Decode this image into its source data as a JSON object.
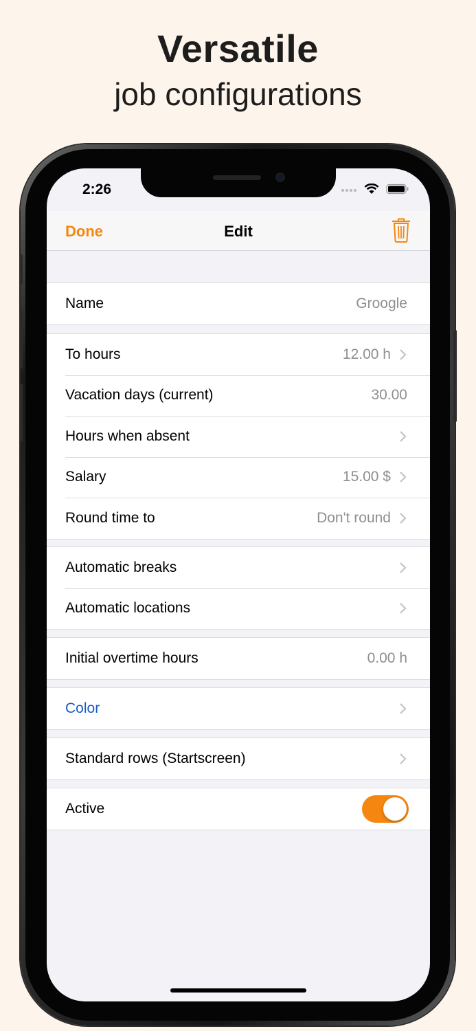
{
  "headline": {
    "title": "Versatile",
    "subtitle": "job configurations"
  },
  "status_bar": {
    "time": "2:26"
  },
  "nav": {
    "done_label": "Done",
    "title": "Edit",
    "trash_icon": "trash-icon"
  },
  "sections": {
    "name": {
      "label": "Name",
      "value": "Groogle"
    },
    "hours": [
      {
        "label": "To hours",
        "value": "12.00 h",
        "chevron": true
      },
      {
        "label": "Vacation days (current)",
        "value": "30.00",
        "chevron": false
      },
      {
        "label": "Hours when absent",
        "value": "",
        "chevron": true
      },
      {
        "label": "Salary",
        "value": "15.00 $",
        "chevron": true
      },
      {
        "label": "Round time to",
        "value": "Don't round",
        "chevron": true
      }
    ],
    "automation": [
      {
        "label": "Automatic breaks",
        "chevron": true
      },
      {
        "label": "Automatic locations",
        "chevron": true
      }
    ],
    "overtime": {
      "label": "Initial overtime hours",
      "value": "0.00 h"
    },
    "color": {
      "label": "Color"
    },
    "rows": {
      "label": "Standard rows (Startscreen)"
    },
    "active": {
      "label": "Active",
      "enabled": true
    }
  },
  "colors": {
    "accent": "#f5860f",
    "link_blue": "#1a5cc6",
    "background": "#fdf5ec"
  }
}
